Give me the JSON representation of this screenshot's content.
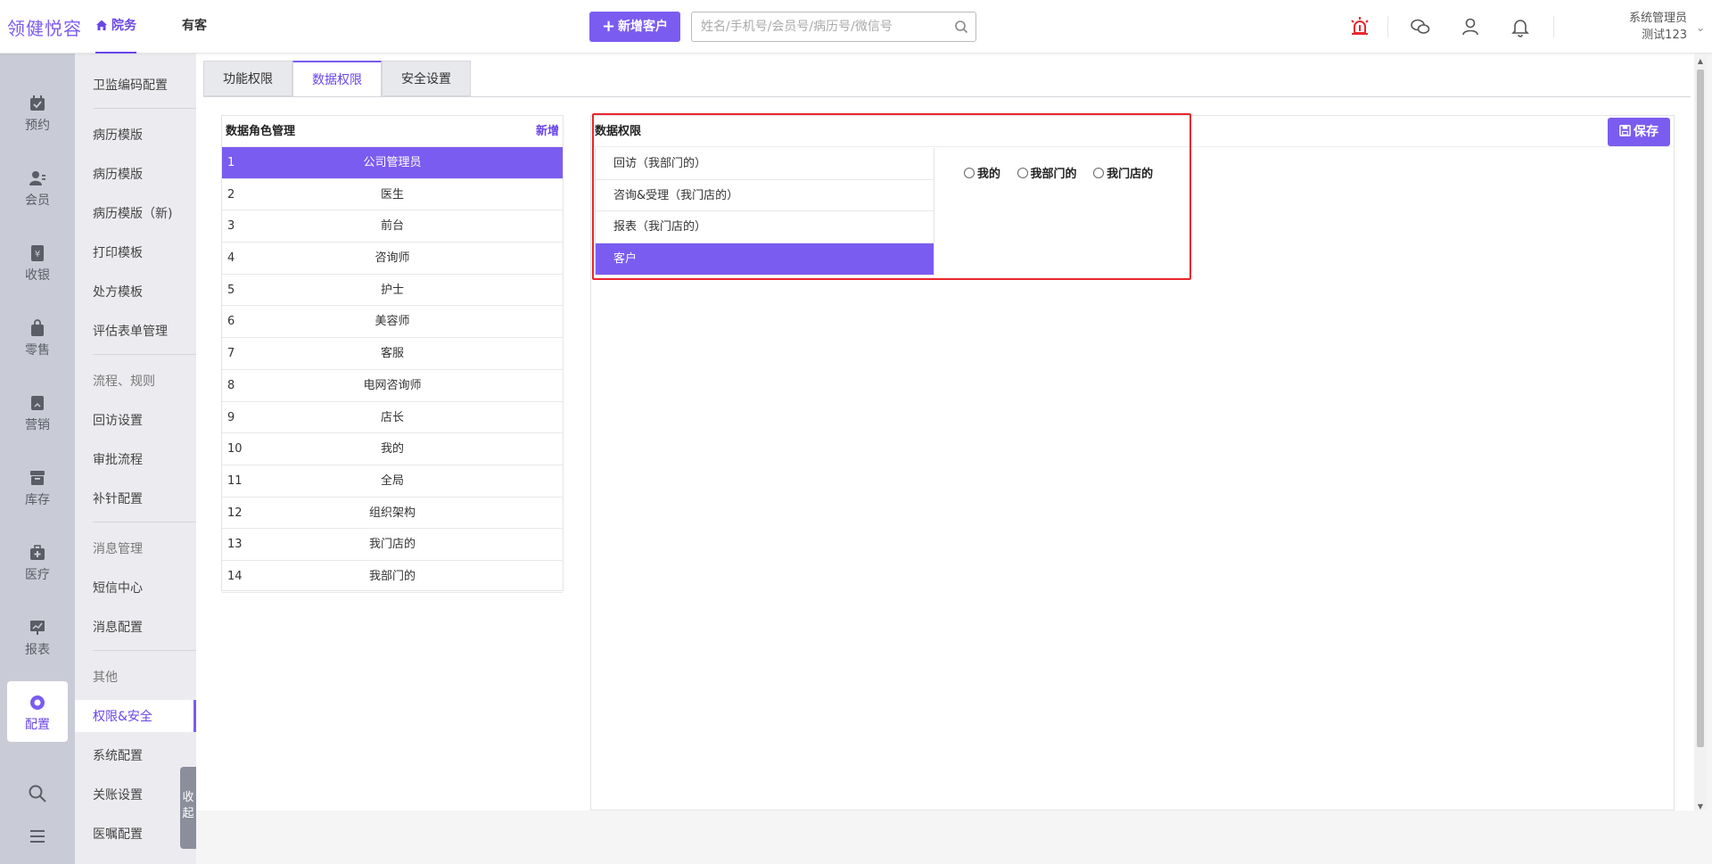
{
  "app": {
    "logo": "领健悦容"
  },
  "topnav": {
    "tabs": [
      {
        "label": "院务",
        "active": true,
        "icon": "home-icon"
      },
      {
        "label": "有客",
        "active": false
      }
    ],
    "new_customer_label": "新增客户",
    "search_placeholder": "姓名/手机号/会员号/病历号/微信号",
    "user": {
      "role": "系统管理员",
      "name": "测试123"
    }
  },
  "rail": {
    "items": [
      {
        "label": "预约",
        "icon": "calendar-icon"
      },
      {
        "label": "会员",
        "icon": "member-icon"
      },
      {
        "label": "收银",
        "icon": "cashier-icon"
      },
      {
        "label": "零售",
        "icon": "bag-icon"
      },
      {
        "label": "营销",
        "icon": "marketing-icon"
      },
      {
        "label": "库存",
        "icon": "inventory-icon"
      },
      {
        "label": "医疗",
        "icon": "medical-icon"
      },
      {
        "label": "报表",
        "icon": "report-icon"
      },
      {
        "label": "配置",
        "icon": "settings-icon",
        "active": true
      }
    ]
  },
  "submenu": {
    "items": [
      {
        "label": "卫监编码配置"
      },
      {
        "label": "病历模版"
      },
      {
        "label": "病历模版"
      },
      {
        "label": "病历模版（新)"
      },
      {
        "label": "打印模板"
      },
      {
        "label": "处方模板"
      },
      {
        "label": "评估表单管理"
      },
      {
        "label": "流程、规则",
        "group": true
      },
      {
        "label": "回访设置"
      },
      {
        "label": "审批流程"
      },
      {
        "label": "补针配置"
      },
      {
        "label": "消息管理",
        "group": true
      },
      {
        "label": "短信中心"
      },
      {
        "label": "消息配置"
      },
      {
        "label": "其他",
        "group": true
      },
      {
        "label": "权限&安全",
        "active": true
      },
      {
        "label": "系统配置"
      },
      {
        "label": "关账设置"
      },
      {
        "label": "医嘱配置"
      }
    ],
    "collapse_label": "收起"
  },
  "tabs": [
    {
      "label": "功能权限"
    },
    {
      "label": "数据权限",
      "active": true
    },
    {
      "label": "安全设置"
    }
  ],
  "role_panel": {
    "title": "数据角色管理",
    "add_label": "新增",
    "rows": [
      {
        "num": "1",
        "name": "公司管理员",
        "selected": true
      },
      {
        "num": "2",
        "name": "医生"
      },
      {
        "num": "3",
        "name": "前台"
      },
      {
        "num": "4",
        "name": "咨询师"
      },
      {
        "num": "5",
        "name": "护士"
      },
      {
        "num": "6",
        "name": "美容师"
      },
      {
        "num": "7",
        "name": "客服"
      },
      {
        "num": "8",
        "name": "电网咨询师"
      },
      {
        "num": "9",
        "name": "店长"
      },
      {
        "num": "10",
        "name": "我的"
      },
      {
        "num": "11",
        "name": "全局"
      },
      {
        "num": "12",
        "name": "组织架构"
      },
      {
        "num": "13",
        "name": "我门店的"
      },
      {
        "num": "14",
        "name": "我部门的"
      }
    ]
  },
  "perm_panel": {
    "title": "数据权限",
    "save_label": "保存",
    "items": [
      {
        "label": "回访（我部门的）"
      },
      {
        "label": "咨询&受理（我门店的）"
      },
      {
        "label": "报表（我门店的）"
      },
      {
        "label": "客户",
        "selected": true
      }
    ],
    "options": [
      {
        "label": "我的"
      },
      {
        "label": "我部门的"
      },
      {
        "label": "我门店的"
      }
    ]
  },
  "colors": {
    "accent": "#7b5cf0",
    "highlight_box": "#e8262c",
    "alert_icon": "#e8262c"
  }
}
